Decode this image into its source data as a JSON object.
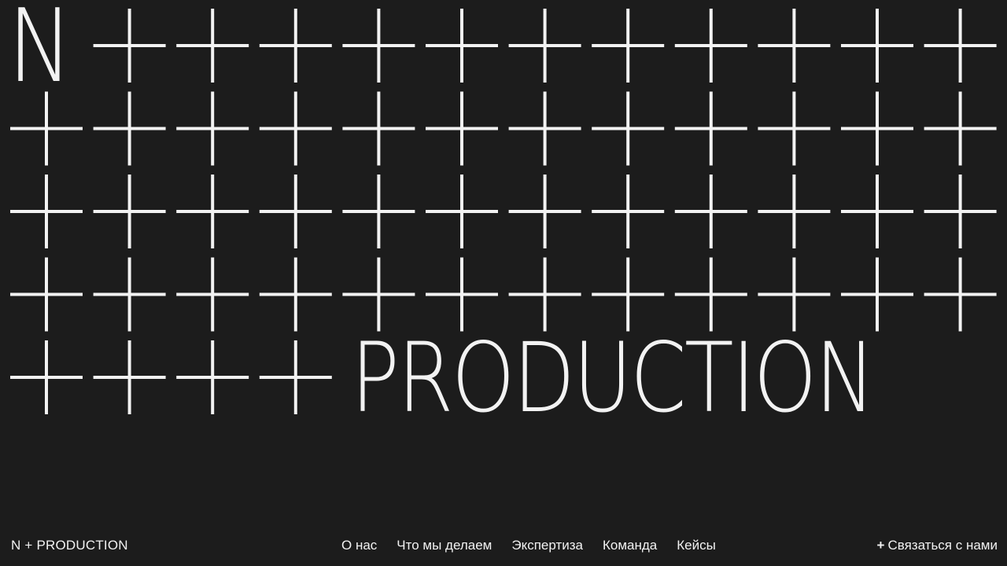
{
  "hero": {
    "letter": "N",
    "word": "PRODUCTION"
  },
  "footer": {
    "brand": "N + PRODUCTION",
    "nav": [
      "О нас",
      "Что мы делаем",
      "Экспертиза",
      "Команда",
      "Кейсы"
    ],
    "contact_label": "Связаться с нами"
  },
  "colors": {
    "background": "#1c1c1c",
    "foreground": "#f2f2f2"
  },
  "icons": {
    "contact": "plus-icon",
    "pattern": "plus-icon"
  }
}
